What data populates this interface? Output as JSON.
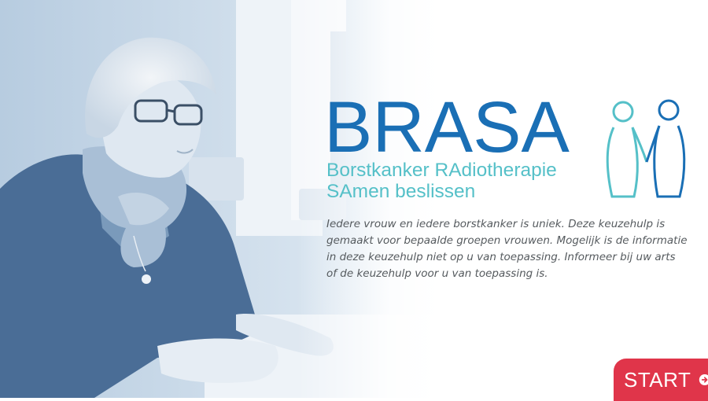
{
  "brand": {
    "title": "BRASA",
    "subtitle_line1": "Borstkanker RAdiotherapie",
    "subtitle_line2": "SAmen beslissen",
    "colors": {
      "primary": "#1a6fb5",
      "accent": "#55c0c8"
    }
  },
  "intro_text": "Iedere vrouw en iedere borstkanker is uniek. Deze keuzehulp is gemaakt voor bepaalde groepen vrouwen. Mogelijk is de informatie in deze keuzehulp niet op u van toepassing. Informeer bij uw arts of de keuzehulp voor u van toepassing is.",
  "start": {
    "label": "START",
    "icon": "arrow-circle-right-icon",
    "color": "#e0354a"
  },
  "photo": {
    "icon": "woman-portrait-photo"
  },
  "logo": {
    "icon": "two-figures-logo-icon"
  }
}
